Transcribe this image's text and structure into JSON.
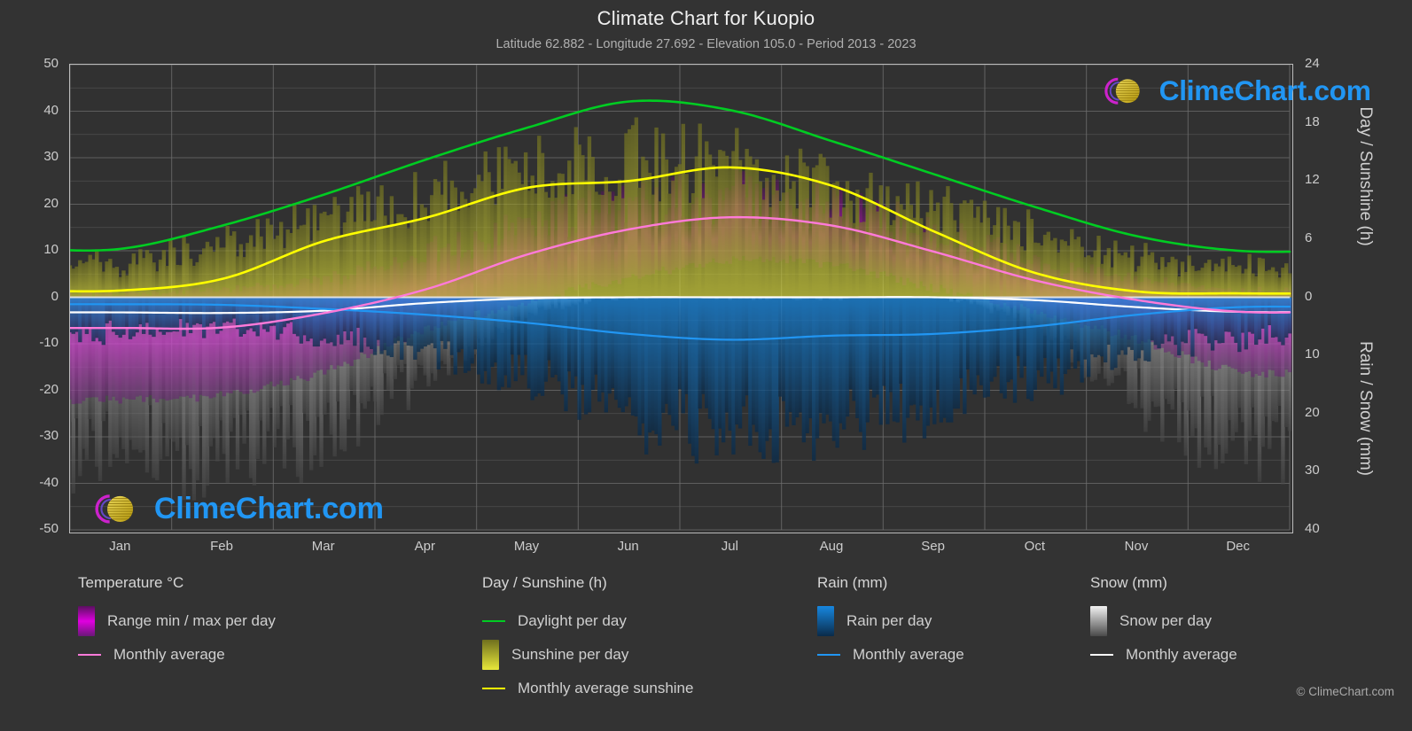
{
  "header": {
    "title": "Climate Chart for Kuopio",
    "subtitle": "Latitude 62.882 - Longitude 27.692 - Elevation 105.0 - Period 2013 - 2023"
  },
  "axes": {
    "left_label": "Temperature °C",
    "right_label_top": "Day / Sunshine (h)",
    "right_label_bottom": "Rain / Snow (mm)",
    "left_ticks": [
      "50",
      "40",
      "30",
      "20",
      "10",
      "0",
      "-10",
      "-20",
      "-30",
      "-40",
      "-50"
    ],
    "right_ticks_top": [
      "24",
      "18",
      "12",
      "6",
      "0"
    ],
    "right_ticks_bottom": [
      "10",
      "20",
      "30",
      "40"
    ],
    "x_ticks": [
      "Jan",
      "Feb",
      "Mar",
      "Apr",
      "May",
      "Jun",
      "Jul",
      "Aug",
      "Sep",
      "Oct",
      "Nov",
      "Dec"
    ]
  },
  "legend": {
    "temperature": {
      "heading": "Temperature °C",
      "range_label": "Range min / max per day",
      "average_label": "Monthly average"
    },
    "sunshine": {
      "heading": "Day / Sunshine (h)",
      "daylight_label": "Daylight per day",
      "sunshine_label": "Sunshine per day",
      "average_label": "Monthly average sunshine"
    },
    "rain": {
      "heading": "Rain (mm)",
      "daily_label": "Rain per day",
      "average_label": "Monthly average"
    },
    "snow": {
      "heading": "Snow (mm)",
      "daily_label": "Snow per day",
      "average_label": "Monthly average"
    }
  },
  "watermark": {
    "text": "ClimeChart.com"
  },
  "credit": "© ClimeChart.com",
  "colors": {
    "background": "#333333",
    "plot_background": "#313131",
    "grid": "#6e6e6e",
    "axis": "#bbbbbb",
    "temperature_range": "#e000e0",
    "temperature_average": "#ff7ad9",
    "daylight": "#00cc22",
    "sunshine": "#e8e83a",
    "sunshine_average": "#ffff00",
    "rain": "#1787e0",
    "rain_average": "#2196f3",
    "snow": "#e8e8e8",
    "snow_average": "#ffffff",
    "logo_text": "#2196f3",
    "logo_arc": "#cc22cc",
    "logo_sphere": "#e3cc22"
  },
  "chart_data": {
    "type": "line",
    "title": "Climate Chart for Kuopio",
    "subtitle": "Latitude 62.882 - Longitude 27.692 - Elevation 105.0 - Period 2013 - 2023",
    "xlabel": "",
    "ylabel": "Temperature °C",
    "ylim": [
      -50,
      50
    ],
    "y2lim_day_sunshine": [
      0,
      24
    ],
    "y2lim_rain_snow": [
      0,
      40
    ],
    "grid": true,
    "legend_position": "below",
    "categories": [
      "Jan",
      "Feb",
      "Mar",
      "Apr",
      "May",
      "Jun",
      "Jul",
      "Aug",
      "Sep",
      "Oct",
      "Nov",
      "Dec"
    ],
    "series": [
      {
        "name": "Daylight per day",
        "unit": "h",
        "axis": "day_sunshine",
        "color": "#00cc22",
        "values": [
          5.0,
          7.4,
          10.6,
          14.2,
          17.5,
          20.2,
          19.3,
          16.1,
          12.7,
          9.3,
          6.3,
          4.8
        ]
      },
      {
        "name": "Monthly average sunshine",
        "unit": "h",
        "axis": "day_sunshine",
        "color": "#ffff00",
        "values": [
          0.7,
          1.9,
          5.8,
          8.2,
          11.3,
          12.0,
          13.4,
          11.5,
          6.8,
          2.5,
          0.6,
          0.4
        ]
      },
      {
        "name": "Temperature monthly average",
        "unit": "°C",
        "axis": "temperature",
        "color": "#ff7ad9",
        "values": [
          -6.6,
          -6.5,
          -3.4,
          1.7,
          9.2,
          14.6,
          17.2,
          15.4,
          9.8,
          3.6,
          -0.6,
          -3.1
        ]
      },
      {
        "name": "Rain monthly average",
        "unit": "mm",
        "axis": "rain_snow",
        "color": "#2196f3",
        "values": [
          1.2,
          1.3,
          2.0,
          3.0,
          4.4,
          6.3,
          7.3,
          6.6,
          6.3,
          5.0,
          3.0,
          1.7
        ]
      },
      {
        "name": "Snow monthly average",
        "unit": "mm",
        "axis": "rain_snow",
        "color": "#ffffff",
        "values": [
          2.6,
          2.7,
          2.3,
          1.0,
          0.2,
          0.0,
          0.0,
          0.0,
          0.0,
          0.5,
          1.7,
          2.5
        ]
      }
    ],
    "bands": [
      {
        "name": "Range min / max per day",
        "unit": "°C",
        "axis": "temperature",
        "color": "#e000e0",
        "min": [
          -22.0,
          -21.0,
          -16.0,
          -7.0,
          -1.0,
          4.0,
          8.0,
          7.0,
          2.0,
          -3.0,
          -9.0,
          -16.0
        ],
        "max": [
          1.0,
          2.0,
          5.0,
          12.0,
          20.0,
          25.0,
          28.0,
          25.0,
          18.0,
          10.0,
          5.0,
          2.0
        ]
      },
      {
        "name": "Sunshine per day",
        "unit": "h",
        "axis": "day_sunshine",
        "color": "#e8e83a",
        "min": [
          0.0,
          0.0,
          0.0,
          0.0,
          0.0,
          0.0,
          0.0,
          0.0,
          0.0,
          0.0,
          0.0,
          0.0
        ],
        "max": [
          4.6,
          7.0,
          10.2,
          13.8,
          17.0,
          18.1,
          17.6,
          15.2,
          11.8,
          8.4,
          5.4,
          4.1
        ]
      },
      {
        "name": "Rain per day",
        "unit": "mm",
        "axis": "rain_snow",
        "color": "#1787e0",
        "min": [
          0.0,
          0.0,
          0.0,
          0.0,
          0.0,
          0.0,
          0.0,
          0.0,
          0.0,
          0.0,
          0.0,
          0.0
        ],
        "max": [
          8.0,
          7.0,
          9.0,
          12.0,
          18.0,
          26.0,
          30.0,
          28.0,
          24.0,
          18.0,
          12.0,
          9.0
        ]
      },
      {
        "name": "Snow per day",
        "unit": "mm",
        "axis": "rain_snow",
        "color": "#e8e8e8",
        "min": [
          0.0,
          0.0,
          0.0,
          0.0,
          0.0,
          0.0,
          0.0,
          0.0,
          0.0,
          0.0,
          0.0,
          0.0
        ],
        "max": [
          34.0,
          36.0,
          30.0,
          18.0,
          4.0,
          0.0,
          0.0,
          0.0,
          0.0,
          6.0,
          22.0,
          32.0
        ]
      }
    ]
  }
}
